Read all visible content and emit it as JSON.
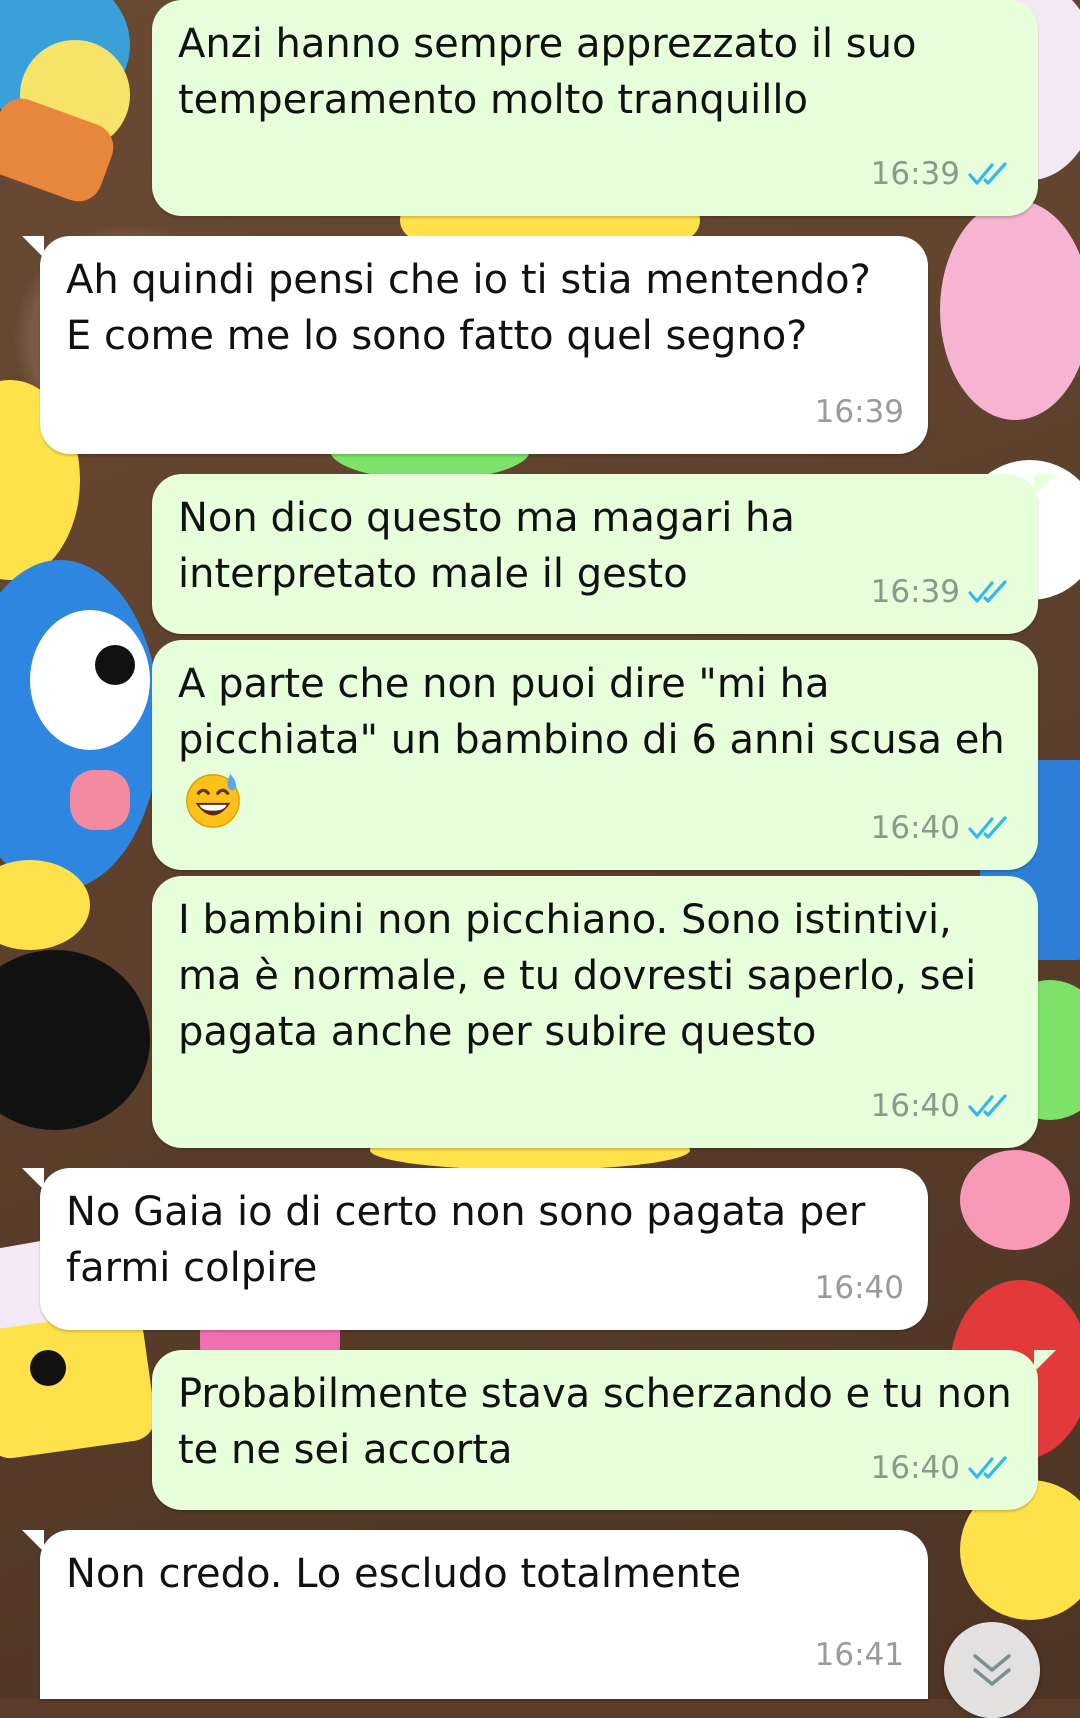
{
  "messages": [
    {
      "direction": "out",
      "text": "Anzi hanno sempre apprezzato il suo temperamento molto tranquillo",
      "time": "16:39",
      "status": "read"
    },
    {
      "direction": "in",
      "text": "Ah quindi pensi che io ti stia mentendo? E come me lo sono fatto quel segno?",
      "time": "16:39"
    },
    {
      "direction": "out",
      "text": "Non dico questo ma magari ha interpretato male il gesto",
      "time": "16:39",
      "status": "read"
    },
    {
      "direction": "out",
      "text": "A parte che non puoi dire \"mi ha picchiata\" un bambino di 6 anni scusa eh",
      "emoji": "grinning-face-with-sweat",
      "time": "16:40",
      "status": "read"
    },
    {
      "direction": "out",
      "text": "I bambini non picchiano. Sono istintivi, ma è normale, e tu dovresti saperlo, sei pagata anche per subire questo",
      "time": "16:40",
      "status": "read"
    },
    {
      "direction": "in",
      "text": "No Gaia io di certo non sono pagata per farmi colpire",
      "time": "16:40"
    },
    {
      "direction": "out",
      "text": "Probabilmente stava scherzando e tu non te ne sei accorta",
      "time": "16:40",
      "status": "read"
    },
    {
      "direction": "in",
      "text": "Non credo. Lo escludo totalmente",
      "time": "16:41"
    }
  ],
  "icons": {
    "read_receipt": "double-check-icon",
    "scroll_down": "double-chevron-down-icon"
  },
  "colors": {
    "outgoing_bubble": "#e7ffdb",
    "incoming_bubble": "#ffffff",
    "read_ticks": "#34b7f1"
  }
}
